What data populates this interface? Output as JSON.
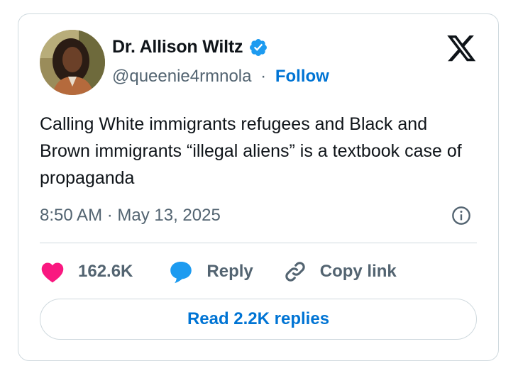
{
  "author": {
    "display_name": "Dr. Allison Wiltz",
    "handle": "@queenie4rmnola",
    "separator": "·",
    "follow_label": "Follow",
    "verified_icon": "verified-badge-icon",
    "avatar_icon": "profile-photo"
  },
  "tweet": {
    "text": "Calling White immigrants refugees and Black and Brown immigrants “illegal aliens” is a textbook case of propaganda",
    "timestamp": "8:50 AM · May 13, 2025"
  },
  "actions": {
    "like_count": "162.6K",
    "reply_label": "Reply",
    "copy_link_label": "Copy link",
    "like_icon": "heart-icon",
    "reply_icon": "speech-bubble-icon",
    "copy_icon": "link-icon",
    "info_icon": "info-icon"
  },
  "read_replies_label": "Read 2.2K replies",
  "colors": {
    "like": "#f91880",
    "reply": "#1d9bf0",
    "link_blue": "#0074d4",
    "muted_text": "#536471",
    "text": "#0f1419",
    "border": "#cfd9de"
  }
}
